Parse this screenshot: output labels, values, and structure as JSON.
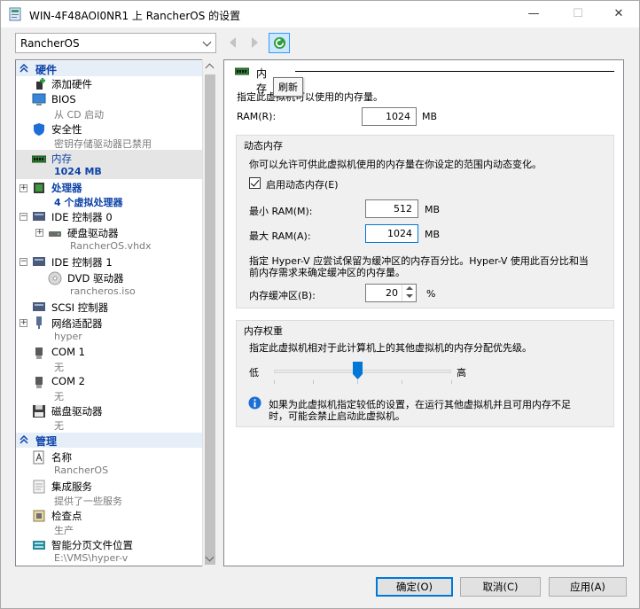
{
  "window": {
    "title": "WIN-4F48AOI0NR1 上 RancherOS 的设置",
    "minimize_glyph": "—",
    "maximize_glyph": "☐",
    "close_glyph": "✕"
  },
  "vm_selector": {
    "value": "RancherOS"
  },
  "toolbar": {
    "refresh_tooltip": "刷新"
  },
  "tree": {
    "hardware_header": "硬件",
    "management_header": "管理",
    "items": [
      {
        "label": "添加硬件",
        "sub": "",
        "icon": "add-hardware-icon"
      },
      {
        "label": "BIOS",
        "sub": "从 CD 启动",
        "icon": "bios-icon"
      },
      {
        "label": "安全性",
        "sub": "密钥存储驱动器已禁用",
        "icon": "shield-icon"
      },
      {
        "label": "内存",
        "sub": "1024 MB",
        "icon": "memory-icon"
      },
      {
        "label": "处理器",
        "sub": "4 个虚拟处理器",
        "icon": "processor-icon"
      },
      {
        "label": "IDE 控制器 0",
        "sub": "",
        "icon": "ide-controller-icon"
      },
      {
        "label": "硬盘驱动器",
        "sub": "RancherOS.vhdx",
        "icon": "hard-drive-icon"
      },
      {
        "label": "IDE 控制器 1",
        "sub": "",
        "icon": "ide-controller-icon"
      },
      {
        "label": "DVD 驱动器",
        "sub": "rancheros.iso",
        "icon": "dvd-icon"
      },
      {
        "label": "SCSI 控制器",
        "sub": "",
        "icon": "scsi-icon"
      },
      {
        "label": "网络适配器",
        "sub": "hyper",
        "icon": "network-adapter-icon"
      },
      {
        "label": "COM 1",
        "sub": "无",
        "icon": "com-port-icon"
      },
      {
        "label": "COM 2",
        "sub": "无",
        "icon": "com-port-icon"
      },
      {
        "label": "磁盘驱动器",
        "sub": "无",
        "icon": "floppy-icon"
      },
      {
        "label": "名称",
        "sub": "RancherOS",
        "icon": "name-icon"
      },
      {
        "label": "集成服务",
        "sub": "提供了一些服务",
        "icon": "integration-services-icon"
      },
      {
        "label": "检查点",
        "sub": "生产",
        "icon": "checkpoint-icon"
      },
      {
        "label": "智能分页文件位置",
        "sub": "E:\\VMS\\hyper-v",
        "icon": "paging-file-icon"
      }
    ]
  },
  "memory_panel": {
    "title": "内存",
    "intro": "指定此虚拟机可以使用的内存量。",
    "ram_label": "RAM(R):",
    "ram_value": "1024",
    "mb": "MB",
    "dynamic_title": "动态内存",
    "dynamic_desc": "你可以允许可供此虚拟机使用的内存量在你设定的范围内动态变化。",
    "enable_dynamic_label": "启用动态内存(E)",
    "enable_dynamic_checked": true,
    "min_ram_label": "最小 RAM(M):",
    "min_ram_value": "512",
    "max_ram_label": "最大 RAM(A):",
    "max_ram_value": "1024",
    "buffer_desc_line1": "指定 Hyper-V 应尝试保留为缓冲区的内存百分比。Hyper-V 使用此百分比和当",
    "buffer_desc_line2": "前内存需求来确定缓冲区的内存量。",
    "buffer_label": "内存缓冲区(B):",
    "buffer_value": "20",
    "percent": "%",
    "weight_title": "内存权重",
    "weight_desc": "指定此虚拟机相对于此计算机上的其他虚拟机的内存分配优先级。",
    "low_label": "低",
    "high_label": "高",
    "weight_level": 0.5,
    "info_line1": "如果为此虚拟机指定较低的设置，在运行其他虚拟机并且可用内存不足",
    "info_line2": "时，可能会禁止启动此虚拟机。"
  },
  "buttons": {
    "ok": "确定(O)",
    "cancel": "取消(C)",
    "apply": "应用(A)"
  },
  "colors": {
    "accent": "#0078d7",
    "tree_header_text": "#0d43a8",
    "refresh_green": "#2e9e3e"
  }
}
